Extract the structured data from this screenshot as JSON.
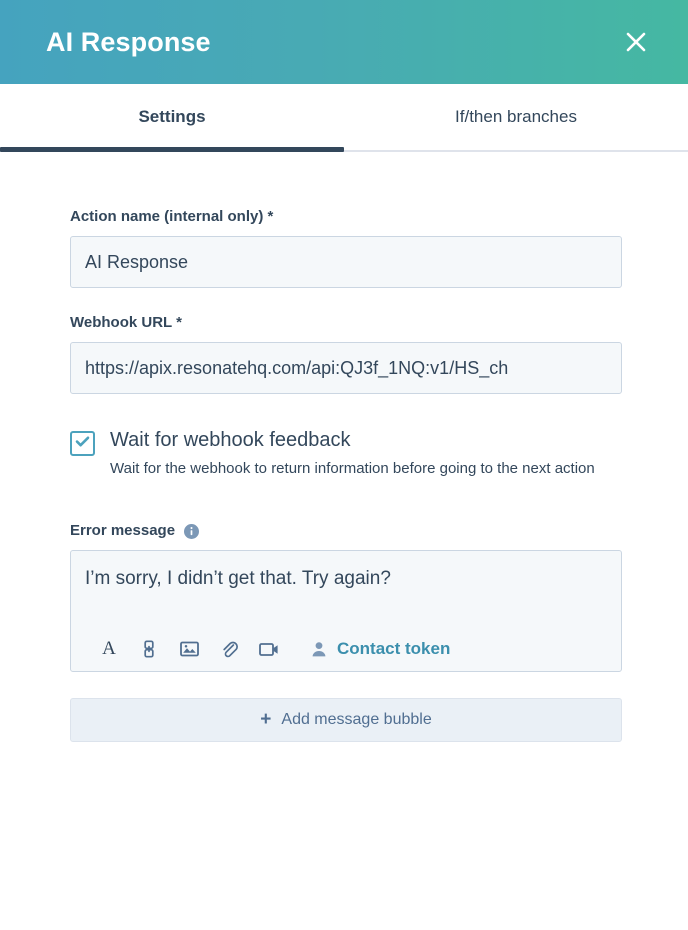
{
  "header": {
    "title": "AI Response",
    "close_label": "Close",
    "gradient_from": "#45a3bf",
    "gradient_to": "#45b8a2"
  },
  "tabs": {
    "active": "Settings",
    "items": [
      {
        "label": "Settings"
      },
      {
        "label": "If/then branches"
      }
    ],
    "active_indicator_color": "#33475b"
  },
  "form": {
    "action_name": {
      "label": "Action name (internal only) *",
      "value": "AI Response"
    },
    "webhook_url": {
      "label": "Webhook URL *",
      "value": "https://apix.resonatehq.com/api:QJ3f_1NQ:v1/HS_ch"
    },
    "wait_for_feedback": {
      "title": "Wait for webhook feedback",
      "description": "Wait for the webhook to return information before going to the next action",
      "checked": true,
      "accent_color": "#4ca2bd"
    },
    "error_message": {
      "label": "Error message",
      "info_icon": "info-icon",
      "value": "I’m sorry, I didn’t get that. Try again?",
      "toolbar": [
        {
          "icon": "text-format-icon",
          "label": "A"
        },
        {
          "icon": "link-icon"
        },
        {
          "icon": "image-icon"
        },
        {
          "icon": "attachment-icon"
        },
        {
          "icon": "video-icon"
        }
      ],
      "contact_token": {
        "icon": "contact-person-icon",
        "label": "Contact token",
        "color": "#3b8fad"
      }
    },
    "add_message_bubble": {
      "icon": "plus-icon",
      "label": "Add message bubble"
    }
  }
}
